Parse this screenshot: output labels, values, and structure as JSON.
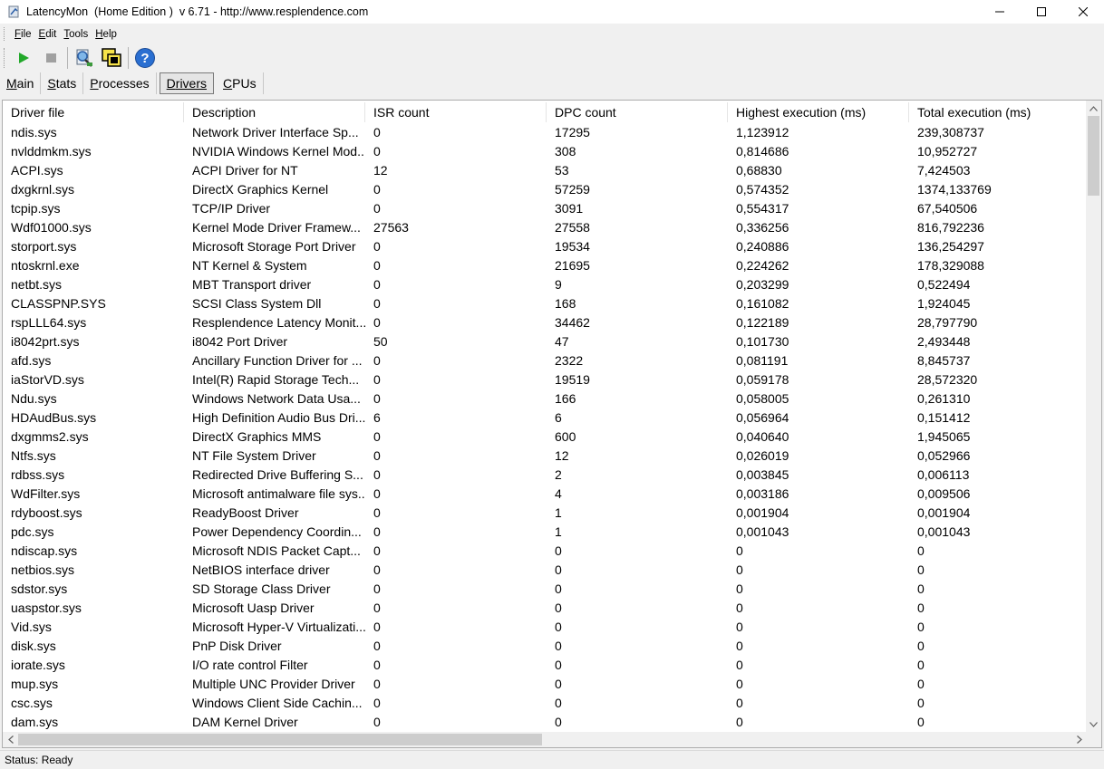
{
  "window": {
    "title": "LatencyMon  (Home Edition )  v 6.71 - http://www.resplendence.com"
  },
  "menu": [
    {
      "ul": "F",
      "rest": "ile"
    },
    {
      "ul": "E",
      "rest": "dit"
    },
    {
      "ul": "T",
      "rest": "ools"
    },
    {
      "ul": "H",
      "rest": "elp"
    }
  ],
  "toolbar": {
    "icons": [
      "play-icon",
      "stop-icon",
      "driver-search-icon",
      "cpu-windows-icon",
      "help-icon"
    ],
    "colors": {
      "play": "#22a82a",
      "stop": "#a0a0a0",
      "help": "#2a6fd1"
    }
  },
  "tabs": [
    {
      "ul": "M",
      "rest": "ain",
      "active": false
    },
    {
      "ul": "S",
      "rest": "tats",
      "active": false
    },
    {
      "ul": "P",
      "rest": "rocesses",
      "active": false
    },
    {
      "ul": "D",
      "rest": "rivers",
      "active": true
    },
    {
      "ul": "C",
      "rest": "PUs",
      "active": false
    }
  ],
  "table": {
    "columns": [
      "Driver file",
      "Description",
      "ISR count",
      "DPC count",
      "Highest execution (ms)",
      "Total execution (ms)"
    ],
    "rows": [
      [
        "ndis.sys",
        "Network Driver Interface Sp...",
        "0",
        "17295",
        "1,123912",
        "239,308737"
      ],
      [
        "nvlddmkm.sys",
        "NVIDIA Windows Kernel Mod...",
        "0",
        "308",
        "0,814686",
        "10,952727"
      ],
      [
        "ACPI.sys",
        "ACPI Driver for NT",
        "12",
        "53",
        "0,68830",
        "7,424503"
      ],
      [
        "dxgkrnl.sys",
        "DirectX Graphics Kernel",
        "0",
        "57259",
        "0,574352",
        "1374,133769"
      ],
      [
        "tcpip.sys",
        "TCP/IP Driver",
        "0",
        "3091",
        "0,554317",
        "67,540506"
      ],
      [
        "Wdf01000.sys",
        "Kernel Mode Driver Framew...",
        "27563",
        "27558",
        "0,336256",
        "816,792236"
      ],
      [
        "storport.sys",
        "Microsoft Storage Port Driver",
        "0",
        "19534",
        "0,240886",
        "136,254297"
      ],
      [
        "ntoskrnl.exe",
        "NT Kernel & System",
        "0",
        "21695",
        "0,224262",
        "178,329088"
      ],
      [
        "netbt.sys",
        "MBT Transport driver",
        "0",
        "9",
        "0,203299",
        "0,522494"
      ],
      [
        "CLASSPNP.SYS",
        "SCSI Class System Dll",
        "0",
        "168",
        "0,161082",
        "1,924045"
      ],
      [
        "rspLLL64.sys",
        "Resplendence Latency Monit...",
        "0",
        "34462",
        "0,122189",
        "28,797790"
      ],
      [
        "i8042prt.sys",
        "i8042 Port Driver",
        "50",
        "47",
        "0,101730",
        "2,493448"
      ],
      [
        "afd.sys",
        "Ancillary Function Driver for ...",
        "0",
        "2322",
        "0,081191",
        "8,845737"
      ],
      [
        "iaStorVD.sys",
        "Intel(R) Rapid Storage Tech...",
        "0",
        "19519",
        "0,059178",
        "28,572320"
      ],
      [
        "Ndu.sys",
        "Windows Network Data Usa...",
        "0",
        "166",
        "0,058005",
        "0,261310"
      ],
      [
        "HDAudBus.sys",
        "High Definition Audio Bus Dri...",
        "6",
        "6",
        "0,056964",
        "0,151412"
      ],
      [
        "dxgmms2.sys",
        "DirectX Graphics MMS",
        "0",
        "600",
        "0,040640",
        "1,945065"
      ],
      [
        "Ntfs.sys",
        "NT File System Driver",
        "0",
        "12",
        "0,026019",
        "0,052966"
      ],
      [
        "rdbss.sys",
        "Redirected Drive Buffering S...",
        "0",
        "2",
        "0,003845",
        "0,006113"
      ],
      [
        "WdFilter.sys",
        "Microsoft antimalware file sys...",
        "0",
        "4",
        "0,003186",
        "0,009506"
      ],
      [
        "rdyboost.sys",
        "ReadyBoost Driver",
        "0",
        "1",
        "0,001904",
        "0,001904"
      ],
      [
        "pdc.sys",
        "Power Dependency Coordin...",
        "0",
        "1",
        "0,001043",
        "0,001043"
      ],
      [
        "ndiscap.sys",
        "Microsoft NDIS Packet Capt...",
        "0",
        "0",
        "0",
        "0"
      ],
      [
        "netbios.sys",
        "NetBIOS interface driver",
        "0",
        "0",
        "0",
        "0"
      ],
      [
        "sdstor.sys",
        "SD Storage Class Driver",
        "0",
        "0",
        "0",
        "0"
      ],
      [
        "uaspstor.sys",
        "Microsoft Uasp Driver",
        "0",
        "0",
        "0",
        "0"
      ],
      [
        "Vid.sys",
        "Microsoft Hyper-V Virtualizati...",
        "0",
        "0",
        "0",
        "0"
      ],
      [
        "disk.sys",
        "PnP Disk Driver",
        "0",
        "0",
        "0",
        "0"
      ],
      [
        "iorate.sys",
        "I/O rate control Filter",
        "0",
        "0",
        "0",
        "0"
      ],
      [
        "mup.sys",
        "Multiple UNC Provider Driver",
        "0",
        "0",
        "0",
        "0"
      ],
      [
        "csc.sys",
        "Windows Client Side Cachin...",
        "0",
        "0",
        "0",
        "0"
      ],
      [
        "dam.sys",
        "DAM Kernel Driver",
        "0",
        "0",
        "0",
        "0"
      ]
    ]
  },
  "status": {
    "text": "Status: Ready"
  }
}
